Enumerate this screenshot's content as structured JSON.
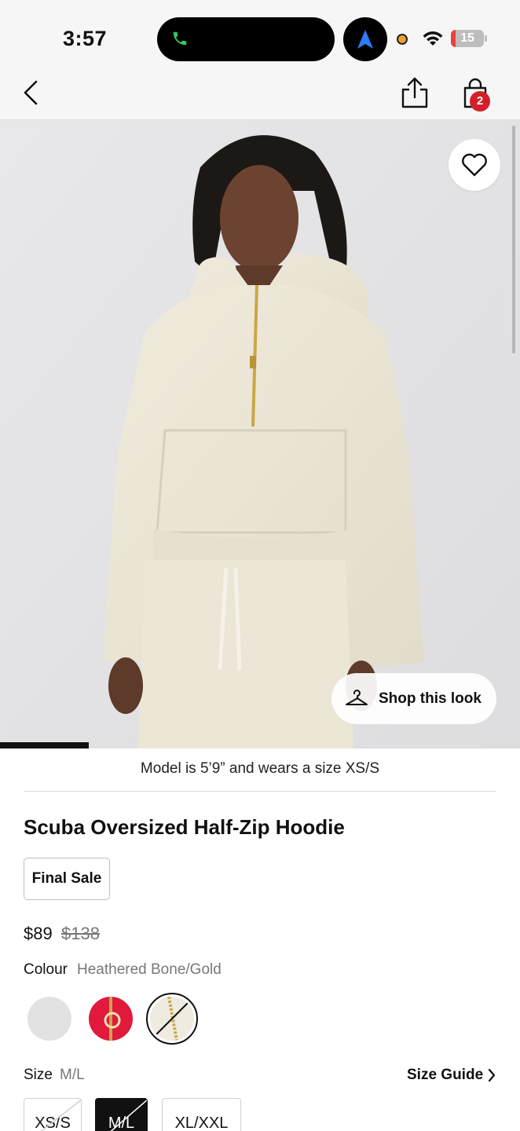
{
  "status_bar": {
    "time": "3:57",
    "battery": "15",
    "battery_level_percent": 15,
    "icons": [
      "phone-call-icon",
      "navigation-arrow-icon",
      "recording-dot-icon",
      "wifi-icon",
      "battery-icon"
    ]
  },
  "nav": {
    "icons": [
      "back-chevron-icon",
      "share-icon",
      "shopping-bag-icon"
    ],
    "bag_count": "2"
  },
  "hero": {
    "favorite_icon": "heart-icon",
    "shop_look_label": "Shop this look",
    "shop_look_icon": "hanger-icon",
    "gallery_progress_fraction": 0.17
  },
  "product": {
    "model_info": "Model is 5’9” and wears a size XS/S",
    "title": "Scuba Oversized Half-Zip Hoodie",
    "badge": "Final Sale",
    "price": "$89",
    "original_price": "$138",
    "colour_label": "Colour",
    "colour_value": "Heathered Bone/Gold",
    "swatches": [
      {
        "name": "Heathered Grey",
        "color": "#e2e2e2",
        "selected": false,
        "unavailable": false
      },
      {
        "name": "Red",
        "color": "#e0193d",
        "selected": false,
        "unavailable": false
      },
      {
        "name": "Heathered Bone/Gold",
        "color": "#efebe0",
        "selected": true,
        "unavailable": true
      }
    ],
    "size_label": "Size",
    "size_value": "M/L",
    "size_guide": "Size Guide",
    "sizes": [
      {
        "label": "XS/S",
        "selected": false,
        "unavailable": true
      },
      {
        "label": "M/L",
        "selected": true,
        "unavailable": true
      },
      {
        "label": "XL/XXL",
        "selected": false,
        "unavailable": false
      }
    ]
  },
  "colors": {
    "badge_red": "#d3202a",
    "hero_bg": "#e6e6e8",
    "hoodie": "#ece6d6"
  }
}
